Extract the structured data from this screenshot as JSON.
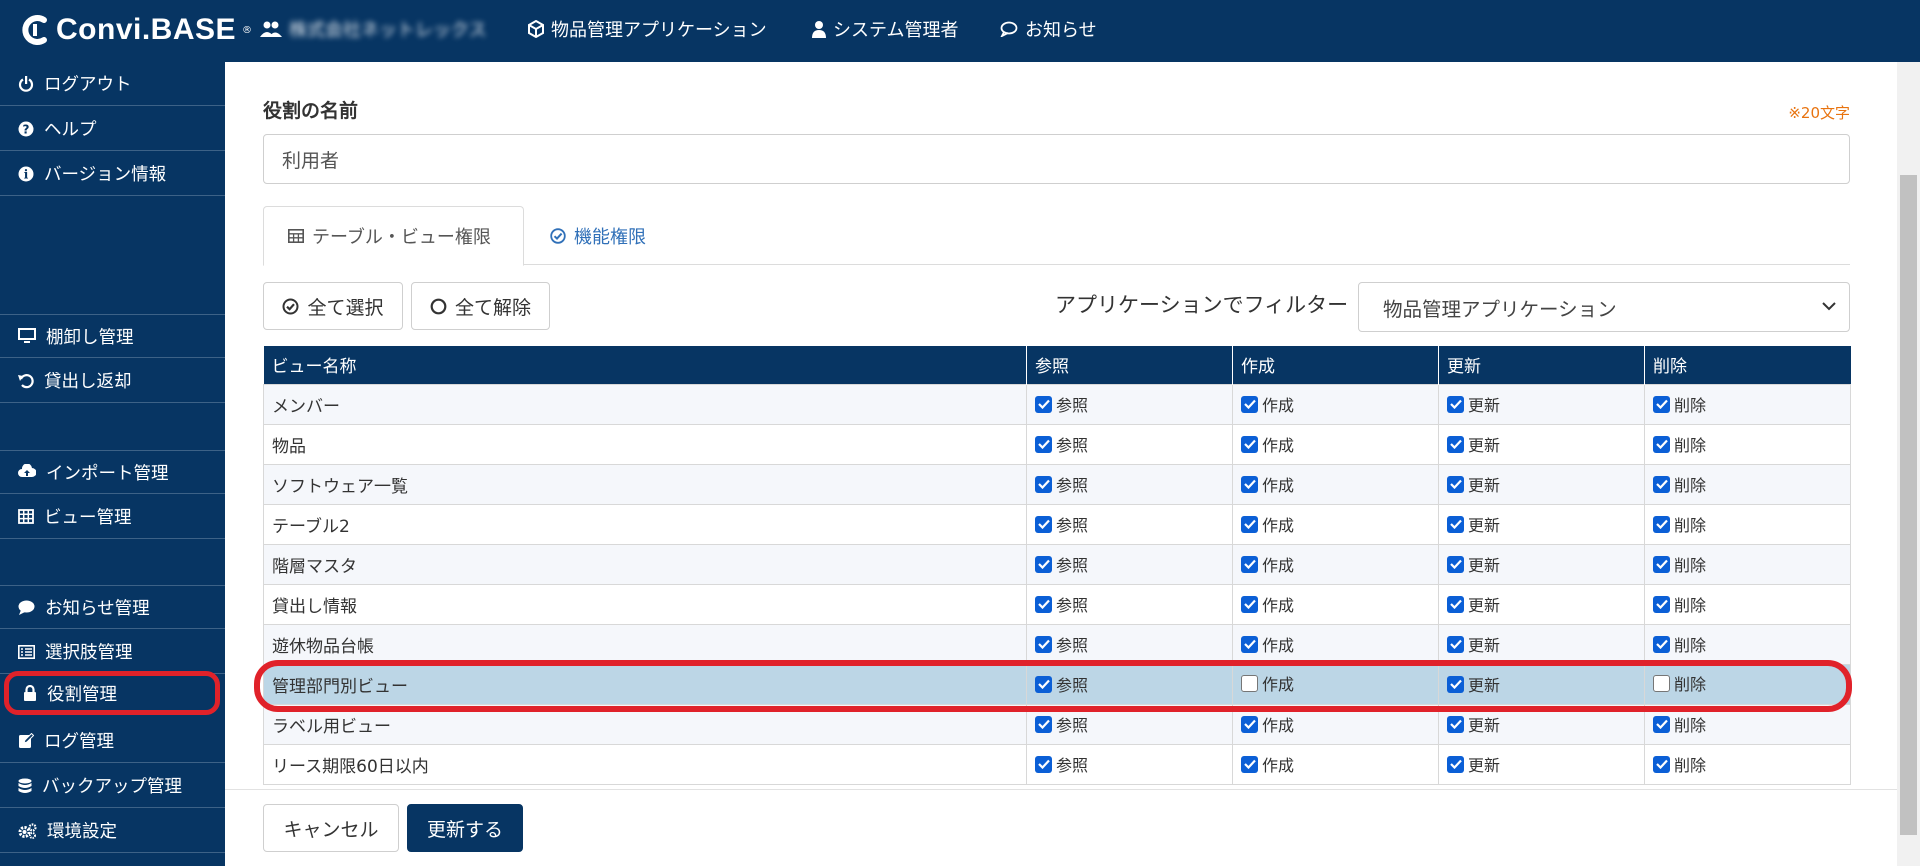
{
  "header": {
    "logo_text": "Convi.BASE",
    "logo_tm": "®",
    "company_name": "株式会社ネットレックス",
    "app_name": "物品管理アプリケーション",
    "user_name": "システム管理者",
    "notice_label": "お知らせ"
  },
  "sidebar": {
    "items": [
      {
        "label": "ログアウト",
        "icon": "power-icon"
      },
      {
        "label": "ヘルプ",
        "icon": "question-circle-icon"
      },
      {
        "label": "バージョン情報",
        "icon": "info-circle-icon"
      },
      {
        "label": "棚卸し管理",
        "icon": "monitor-icon"
      },
      {
        "label": "貸出し返却",
        "icon": "undo-icon"
      },
      {
        "label": "インポート管理",
        "icon": "cloud-upload-icon"
      },
      {
        "label": "ビュー管理",
        "icon": "table-icon"
      },
      {
        "label": "お知らせ管理",
        "icon": "comment-icon"
      },
      {
        "label": "選択肢管理",
        "icon": "list-icon"
      },
      {
        "label": "役割管理",
        "icon": "lock-icon"
      },
      {
        "label": "ログ管理",
        "icon": "edit-icon"
      },
      {
        "label": "バックアップ管理",
        "icon": "database-icon"
      },
      {
        "label": "環境設定",
        "icon": "gears-icon"
      }
    ]
  },
  "form": {
    "role_name_label": "役割の名前",
    "char_limit_note": "※20文字",
    "role_name_value": "利用者"
  },
  "tabs": {
    "table_view": "テーブル・ビュー権限",
    "function": "機能権限"
  },
  "toolbar": {
    "select_all": "全て選択",
    "deselect_all": "全て解除",
    "filter_label": "アプリケーションでフィルター",
    "filter_value": "物品管理アプリケーション"
  },
  "table": {
    "headers": [
      "ビュー名称",
      "参照",
      "作成",
      "更新",
      "削除"
    ],
    "rows": [
      {
        "name": "メンバー",
        "perms": [
          true,
          true,
          true,
          true
        ]
      },
      {
        "name": "物品",
        "perms": [
          true,
          true,
          true,
          true
        ]
      },
      {
        "name": "ソフトウェア一覧",
        "perms": [
          true,
          true,
          true,
          true
        ]
      },
      {
        "name": "テーブル2",
        "perms": [
          true,
          true,
          true,
          true
        ]
      },
      {
        "name": "階層マスタ",
        "perms": [
          true,
          true,
          true,
          true
        ]
      },
      {
        "name": "貸出し情報",
        "perms": [
          true,
          true,
          true,
          true
        ]
      },
      {
        "name": "遊休物品台帳",
        "perms": [
          true,
          true,
          true,
          true
        ]
      },
      {
        "name": "管理部門別ビュー",
        "perms": [
          true,
          false,
          true,
          false
        ]
      },
      {
        "name": "ラベル用ビュー",
        "perms": [
          true,
          true,
          true,
          true
        ]
      },
      {
        "name": "リース期限60日以内",
        "perms": [
          true,
          true,
          true,
          true
        ]
      }
    ],
    "perm_labels": [
      "参照",
      "作成",
      "更新",
      "削除"
    ]
  },
  "footer": {
    "cancel": "キャンセル",
    "update": "更新する"
  },
  "colors": {
    "navy": "#073563",
    "highlight_row": "#bcd6e6",
    "annotation_red": "#e0222a",
    "checkbox_blue": "#0b5fd6",
    "note_orange": "#e8730f"
  }
}
